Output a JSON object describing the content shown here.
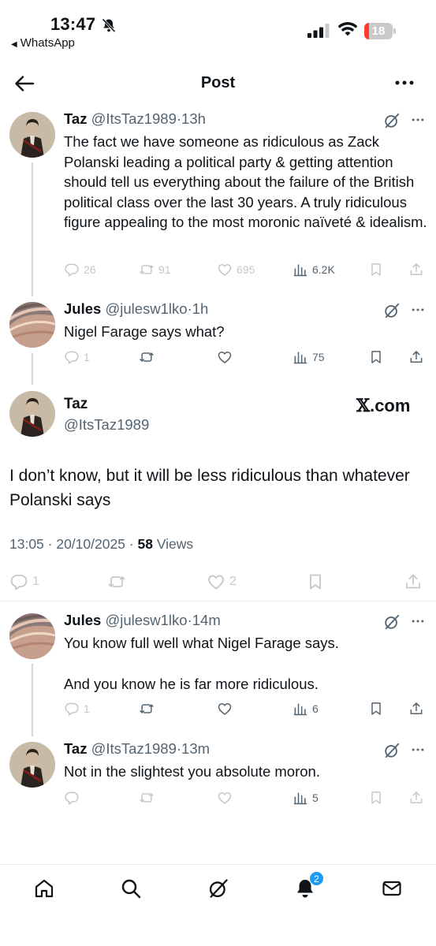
{
  "status_bar": {
    "time": "13:47",
    "back_app": "WhatsApp",
    "battery_percent": 18
  },
  "header": {
    "title": "Post"
  },
  "tweets": [
    {
      "name": "Taz",
      "handle": "@ItsTaz1989",
      "time": "13h",
      "text": [
        "The fact we have someone as ridiculous as Zack Polanski leading a political party & getting attention should tell us everything about the failure of the British political class over the last 30 years. A truly ridiculous figure appealing to the most moronic naïveté & idealism."
      ],
      "replies": "26",
      "reposts": "91",
      "likes": "695",
      "views": "6.2K"
    },
    {
      "name": "Jules",
      "handle": "@julesw1lko",
      "time": "1h",
      "text": [
        "Nigel Farage says what?"
      ],
      "replies": "1",
      "reposts": "",
      "likes": "",
      "views": "75"
    },
    {
      "name": "Jules",
      "handle": "@julesw1lko",
      "time": "14m",
      "text": [
        "You know full well what Nigel Farage says.",
        "And you know he is far more ridiculous."
      ],
      "replies": "1",
      "reposts": "",
      "likes": "",
      "views": "6"
    },
    {
      "name": "Taz",
      "handle": "@ItsTaz1989",
      "time": "13m",
      "text": [
        "Not in the slightest you absolute moron."
      ],
      "replies": "",
      "reposts": "",
      "likes": "",
      "views": "5"
    }
  ],
  "main_tweet": {
    "name": "Taz",
    "handle": "@ItsTaz1989",
    "brand": ".com",
    "text": "I don’t know, but it will be less ridiculous than whatever Polanski says",
    "timestamp": "13:05 · 20/10/2025 · ",
    "views_count": "58",
    "views_label": " Views",
    "replies": "1",
    "likes": "2"
  },
  "nav": {
    "notifications_badge": "2"
  },
  "colors": {
    "text": "#0f1419",
    "secondary": "#536471",
    "accent": "#1d9bf0",
    "battery_low": "#ff3b30"
  },
  "icons": [
    "bell-slash-icon",
    "signal-icon",
    "wifi-icon",
    "battery-icon",
    "back-arrow-icon",
    "more-icon",
    "grok-icon",
    "reply-icon",
    "repost-icon",
    "like-icon",
    "views-icon",
    "bookmark-icon",
    "share-icon",
    "home-icon",
    "search-icon",
    "notifications-icon",
    "messages-icon"
  ]
}
